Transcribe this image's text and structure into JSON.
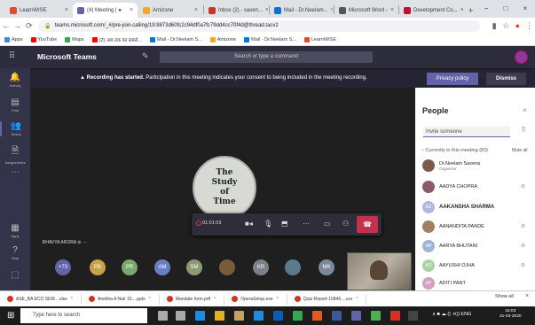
{
  "browser": {
    "tabs": [
      {
        "label": "LearnWISE",
        "color": "#e34c26"
      },
      {
        "label": "(4) Meeting | ●",
        "color": "#6264a7"
      },
      {
        "label": "Amizone",
        "color": "#f5a623"
      },
      {
        "label": "Inbox (2) - saxen...",
        "color": "#d93025"
      },
      {
        "label": "Mail - Dr.Neelam...",
        "color": "#0078d4"
      },
      {
        "label": "Microsoft Word -",
        "color": "#555555"
      },
      {
        "label": "Development Co...",
        "color": "#c8102e"
      }
    ],
    "window_controls": [
      "−",
      "□",
      "×"
    ],
    "url": "teams.microsoft.com/_#/pre-join-calling/19:8873d60fc2c94df0a7fc79dd4cc70f4d@thread.tacv2",
    "bookmarks": [
      {
        "label": "Apps",
        "color": "#4285f4"
      },
      {
        "label": "YouTube",
        "color": "#ff0000"
      },
      {
        "label": "Maps",
        "color": "#34a853"
      },
      {
        "label": "(2) अब तक का सबसे...",
        "color": "#ff0000"
      },
      {
        "label": "Mail - Dr.Neelam S...",
        "color": "#0078d4"
      },
      {
        "label": "Amizone",
        "color": "#f5a623"
      },
      {
        "label": "Mail - Dr.Neelam S...",
        "color": "#0078d4"
      },
      {
        "label": "LearnWISE",
        "color": "#e34c26"
      }
    ]
  },
  "teams": {
    "title": "Microsoft Teams",
    "search_placeholder": "Search or type a command",
    "rail": [
      {
        "icon": "🔔",
        "label": "Activity"
      },
      {
        "icon": "▤",
        "label": "Chat"
      },
      {
        "icon": "👥",
        "label": "Teams"
      },
      {
        "icon": "🗎",
        "label": "Assignments"
      },
      {
        "icon": "⋯",
        "label": ""
      },
      {
        "icon": "▦",
        "label": "Apps"
      },
      {
        "icon": "?",
        "label": "Help"
      },
      {
        "icon": "⬚",
        "label": ""
      }
    ],
    "banner": {
      "bold": "Recording has started.",
      "text": " Participation in this meeting indicates your consent to being included in the meeting recording.",
      "privacy": "Privacy policy",
      "dismiss": "Dismiss"
    },
    "stage_words": [
      "The",
      "Study",
      "of",
      "Time"
    ],
    "call": {
      "timer": "01:01:03",
      "speaker": "BHAVYA ARORA ⊘ ···"
    },
    "avatars": [
      {
        "text": "+73",
        "color": "#6264a7"
      },
      {
        "text": "PB",
        "color": "#c8a24a"
      },
      {
        "text": "PR",
        "color": "#7aa96d"
      },
      {
        "text": "AM",
        "color": "#6a7fc1"
      },
      {
        "text": "SM",
        "color": "#8c9a74"
      },
      {
        "text": "",
        "color": "#7a5b3a"
      },
      {
        "text": "KR",
        "color": "#7b7f8a"
      },
      {
        "text": "",
        "color": "#5b7a8c"
      },
      {
        "text": "MK",
        "color": "#7a8a9c"
      }
    ],
    "people": {
      "title": "People",
      "invite_placeholder": "Invite someone",
      "current_label": "Currently in this meeting (83)",
      "mute_all": "Mute all",
      "members": [
        {
          "initials": "",
          "name": "Dr.Neelam Saxena",
          "role": "Organizer",
          "color": "#7d5a4b",
          "bold": false
        },
        {
          "initials": "",
          "name": "AADYA CHOPRA",
          "role": "",
          "color": "#8c5a6e",
          "bold": false
        },
        {
          "initials": "AS",
          "name": "AAKANSHA SHARMA",
          "role": "",
          "color": "#b4b6e0",
          "bold": true
        },
        {
          "initials": "",
          "name": "AANANDITA PANDE",
          "role": "",
          "color": "#a08060",
          "bold": false
        },
        {
          "initials": "AB",
          "name": "AARYA BHUTANI",
          "role": "",
          "color": "#9eb6d4",
          "bold": false
        },
        {
          "initials": "AO",
          "name": "AAYUSHI OJHA",
          "role": "",
          "color": "#a8d4a0",
          "bold": false
        },
        {
          "initials": "AP",
          "name": "ADITI PANT",
          "role": "",
          "color": "#d4a0c0",
          "bold": false
        }
      ]
    }
  },
  "downloads": [
    {
      "label": "ASE_BA ECO SEM....xlsx"
    },
    {
      "label": "Anekha A Nair 15....pptx"
    },
    {
      "label": "Mandate form.pdf"
    },
    {
      "label": "OperaSetup.exe"
    },
    {
      "label": "Quiz Report-15846....csv"
    }
  ],
  "show_all": "Show all",
  "taskbar": {
    "search": "Type here to search",
    "icons": [
      "#aaaaaa",
      "#aaaaaa",
      "#1f8ce0",
      "#e0b020",
      "#c8a060",
      "#1f8ce0",
      "#0a5db5",
      "#2fa84f",
      "#e55a1c",
      "#3b5998",
      "#6264a7",
      "#4caf50",
      "#d93025",
      "#444444",
      "#6264a7"
    ],
    "tray": "∧ ■ ☁ (( ⊲)) ENG",
    "time": "15:03",
    "date": "31-03-2020"
  }
}
